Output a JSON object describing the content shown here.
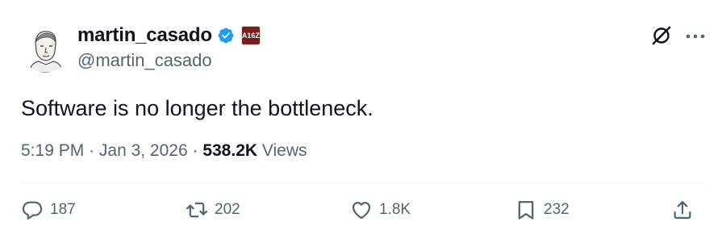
{
  "author": {
    "display_name": "martin_casado",
    "handle": "@martin_casado",
    "verified": true,
    "affiliation_badge": "A16Z"
  },
  "tweet": {
    "text": "Software is no longer the bottleneck.",
    "time": "5:19 PM",
    "separator1": " · ",
    "date": "Jan 3, 2026",
    "separator2": " · ",
    "views_count": "538.2K",
    "views_label": " Views"
  },
  "actions": {
    "replies": "187",
    "reposts": "202",
    "likes": "1.8K",
    "bookmarks": "232"
  },
  "icons": {
    "verified": "verified-badge-icon",
    "grok": "grok-icon",
    "more": "more-icon",
    "reply": "reply-icon",
    "repost": "repost-icon",
    "like": "like-icon",
    "bookmark": "bookmark-icon",
    "share": "share-icon"
  },
  "colors": {
    "verified": "#1d9bf0",
    "secondary_text": "#536471",
    "primary_text": "#0f1419",
    "affiliation_bg": "#7b1d1d"
  }
}
